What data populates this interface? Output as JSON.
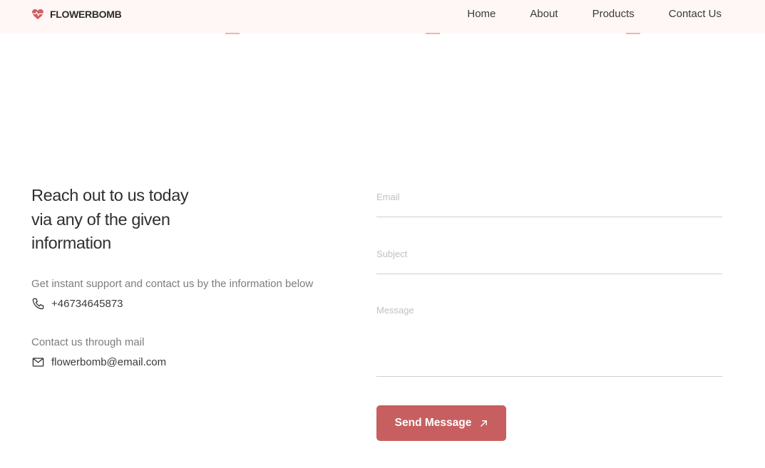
{
  "header": {
    "brand": "FLOWERBOMB",
    "brand_icon": "heart-pulse-icon",
    "nav": [
      {
        "label": "Home"
      },
      {
        "label": "About"
      },
      {
        "label": "Products"
      },
      {
        "label": "Contact Us"
      }
    ]
  },
  "contact": {
    "heading_lines": [
      "Reach out to us today",
      "via any of the given",
      "information"
    ],
    "support_text": "Get instant support and contact us by the information below",
    "phone": "+46734645873",
    "phone_icon": "phone-icon",
    "mail_label": "Contact us through mail",
    "email": "flowerbomb@email.com",
    "mail_icon": "mail-icon"
  },
  "form": {
    "email_placeholder": "Email",
    "subject_placeholder": "Subject",
    "message_placeholder": "Message",
    "submit_label": "Send Message",
    "submit_icon": "arrow-up-right-icon"
  },
  "colors": {
    "accent": "#c75f60",
    "navbar_bg": "#fff7f6",
    "text_dark": "#2f2f2f",
    "text_muted": "#7d7d7d"
  }
}
